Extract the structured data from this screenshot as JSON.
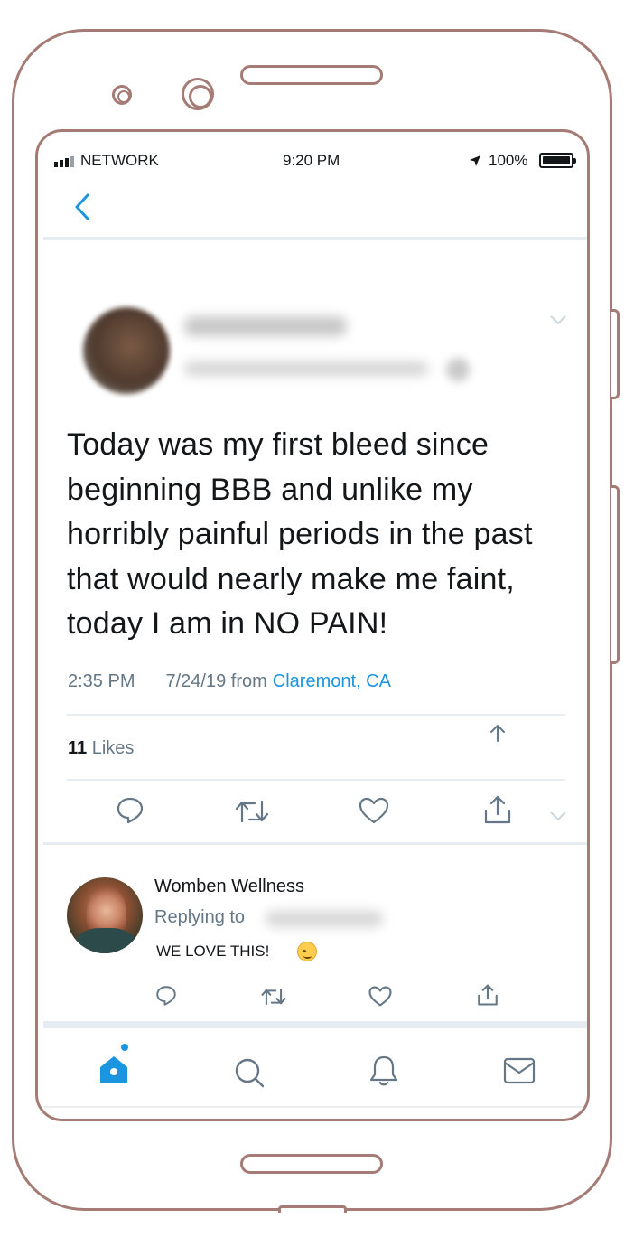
{
  "status_bar": {
    "network": "NETWORK",
    "time": "9:20 PM",
    "battery": "100%"
  },
  "tweet": {
    "text": "Today was my first bleed since beginning BBB and unlike my horribly painful periods in the past that would nearly make me faint, today I am in NO PAIN!",
    "time": "2:35 PM",
    "date": "7/24/19 from",
    "location": "Claremont, CA",
    "likes_count": "11",
    "likes_label": "Likes"
  },
  "reply": {
    "author": "Womben Wellness",
    "replying_to_label": "Replying to",
    "text": "WE LOVE THIS!"
  },
  "colors": {
    "frame": "#a57b76",
    "accent": "#1b95e0",
    "muted": "#657786",
    "divider": "#e6ecf0"
  }
}
